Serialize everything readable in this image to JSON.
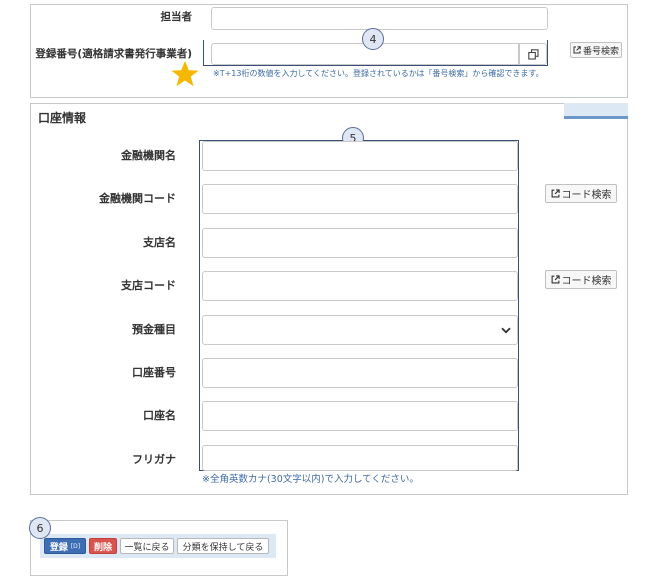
{
  "registrant": {
    "tanto_label": "担当者",
    "toroku_label": "登録番号(適格請求書発行事業者)",
    "toroku_note": "※T+13桁の数値を入力してください。登録されているかは「番号検索」から確認できます。",
    "search_button": "番号検索",
    "badge": "4"
  },
  "bank": {
    "section_title": "口座情報",
    "badge": "5",
    "fields": [
      {
        "label": "金融機関名"
      },
      {
        "label": "金融機関コード",
        "button": "コード検索"
      },
      {
        "label": "支店名"
      },
      {
        "label": "支店コード",
        "button": "コード検索"
      },
      {
        "label": "預金種目"
      },
      {
        "label": "口座番号"
      },
      {
        "label": "口座名"
      },
      {
        "label": "フリガナ"
      }
    ],
    "kana_note": "※全角英数カナ(30文字以内)で入力してください。"
  },
  "actions": {
    "badge": "6",
    "register": "登録",
    "register_key": "[D]",
    "delete": "削除",
    "back_list": "一覧に戻る",
    "back_keep": "分類を保持して戻る"
  },
  "colors": {
    "accent_blue": "#3d6eb4",
    "delete_red": "#d9534f",
    "star": "#f5b800",
    "note_blue": "#3e6aa8"
  }
}
